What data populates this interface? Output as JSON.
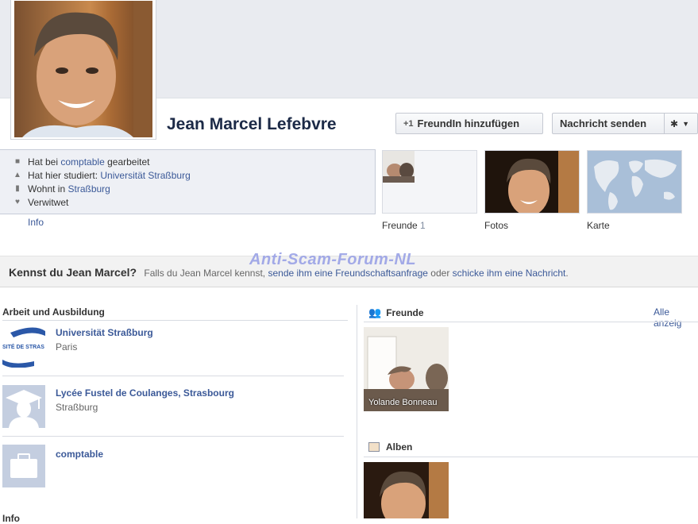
{
  "profile": {
    "name": "Jean Marcel Lefebvre",
    "add_friend_label": "FreundIn hinzufügen",
    "message_label": "Nachricht senden"
  },
  "intro": {
    "work_prefix": "Hat bei",
    "work_link": "comptable",
    "work_suffix": "gearbeitet",
    "study_prefix": "Hat hier studiert:",
    "study_link": "Universität Straßburg",
    "live_prefix": "Wohnt in",
    "live_link": "Straßburg",
    "status": "Verwitwet",
    "info_link": "Info"
  },
  "tiles": {
    "friends_label": "Freunde",
    "friends_count": "1",
    "photos_label": "Fotos",
    "map_label": "Karte"
  },
  "kennst": {
    "title": "Kennst du Jean Marcel?",
    "text1": "Falls du Jean Marcel kennst,",
    "link1": "sende ihm eine Freundschaftsanfrage",
    "text2": "oder",
    "link2": "schicke ihm eine Nachricht",
    "text3": "."
  },
  "watermark": "Anti-Scam-Forum-NL",
  "work": {
    "title": "Arbeit und Ausbildung",
    "entries": [
      {
        "title": "Universität Straßburg",
        "sub": "Paris",
        "logo_text": "SITÉ DE STRAS"
      },
      {
        "title": "Lycée Fustel de Coulanges, Strasbourg",
        "sub": "Straßburg"
      },
      {
        "title": "comptable",
        "sub": ""
      }
    ],
    "info_title": "Info"
  },
  "friends": {
    "title": "Freunde",
    "see_all": "Alle anzeig",
    "friend_name": "Yolande Bonneau"
  },
  "albums": {
    "title": "Alben"
  },
  "colors": {
    "link": "#3b5998",
    "name": "#1c2a47",
    "watermark": "#9aa2e6"
  }
}
